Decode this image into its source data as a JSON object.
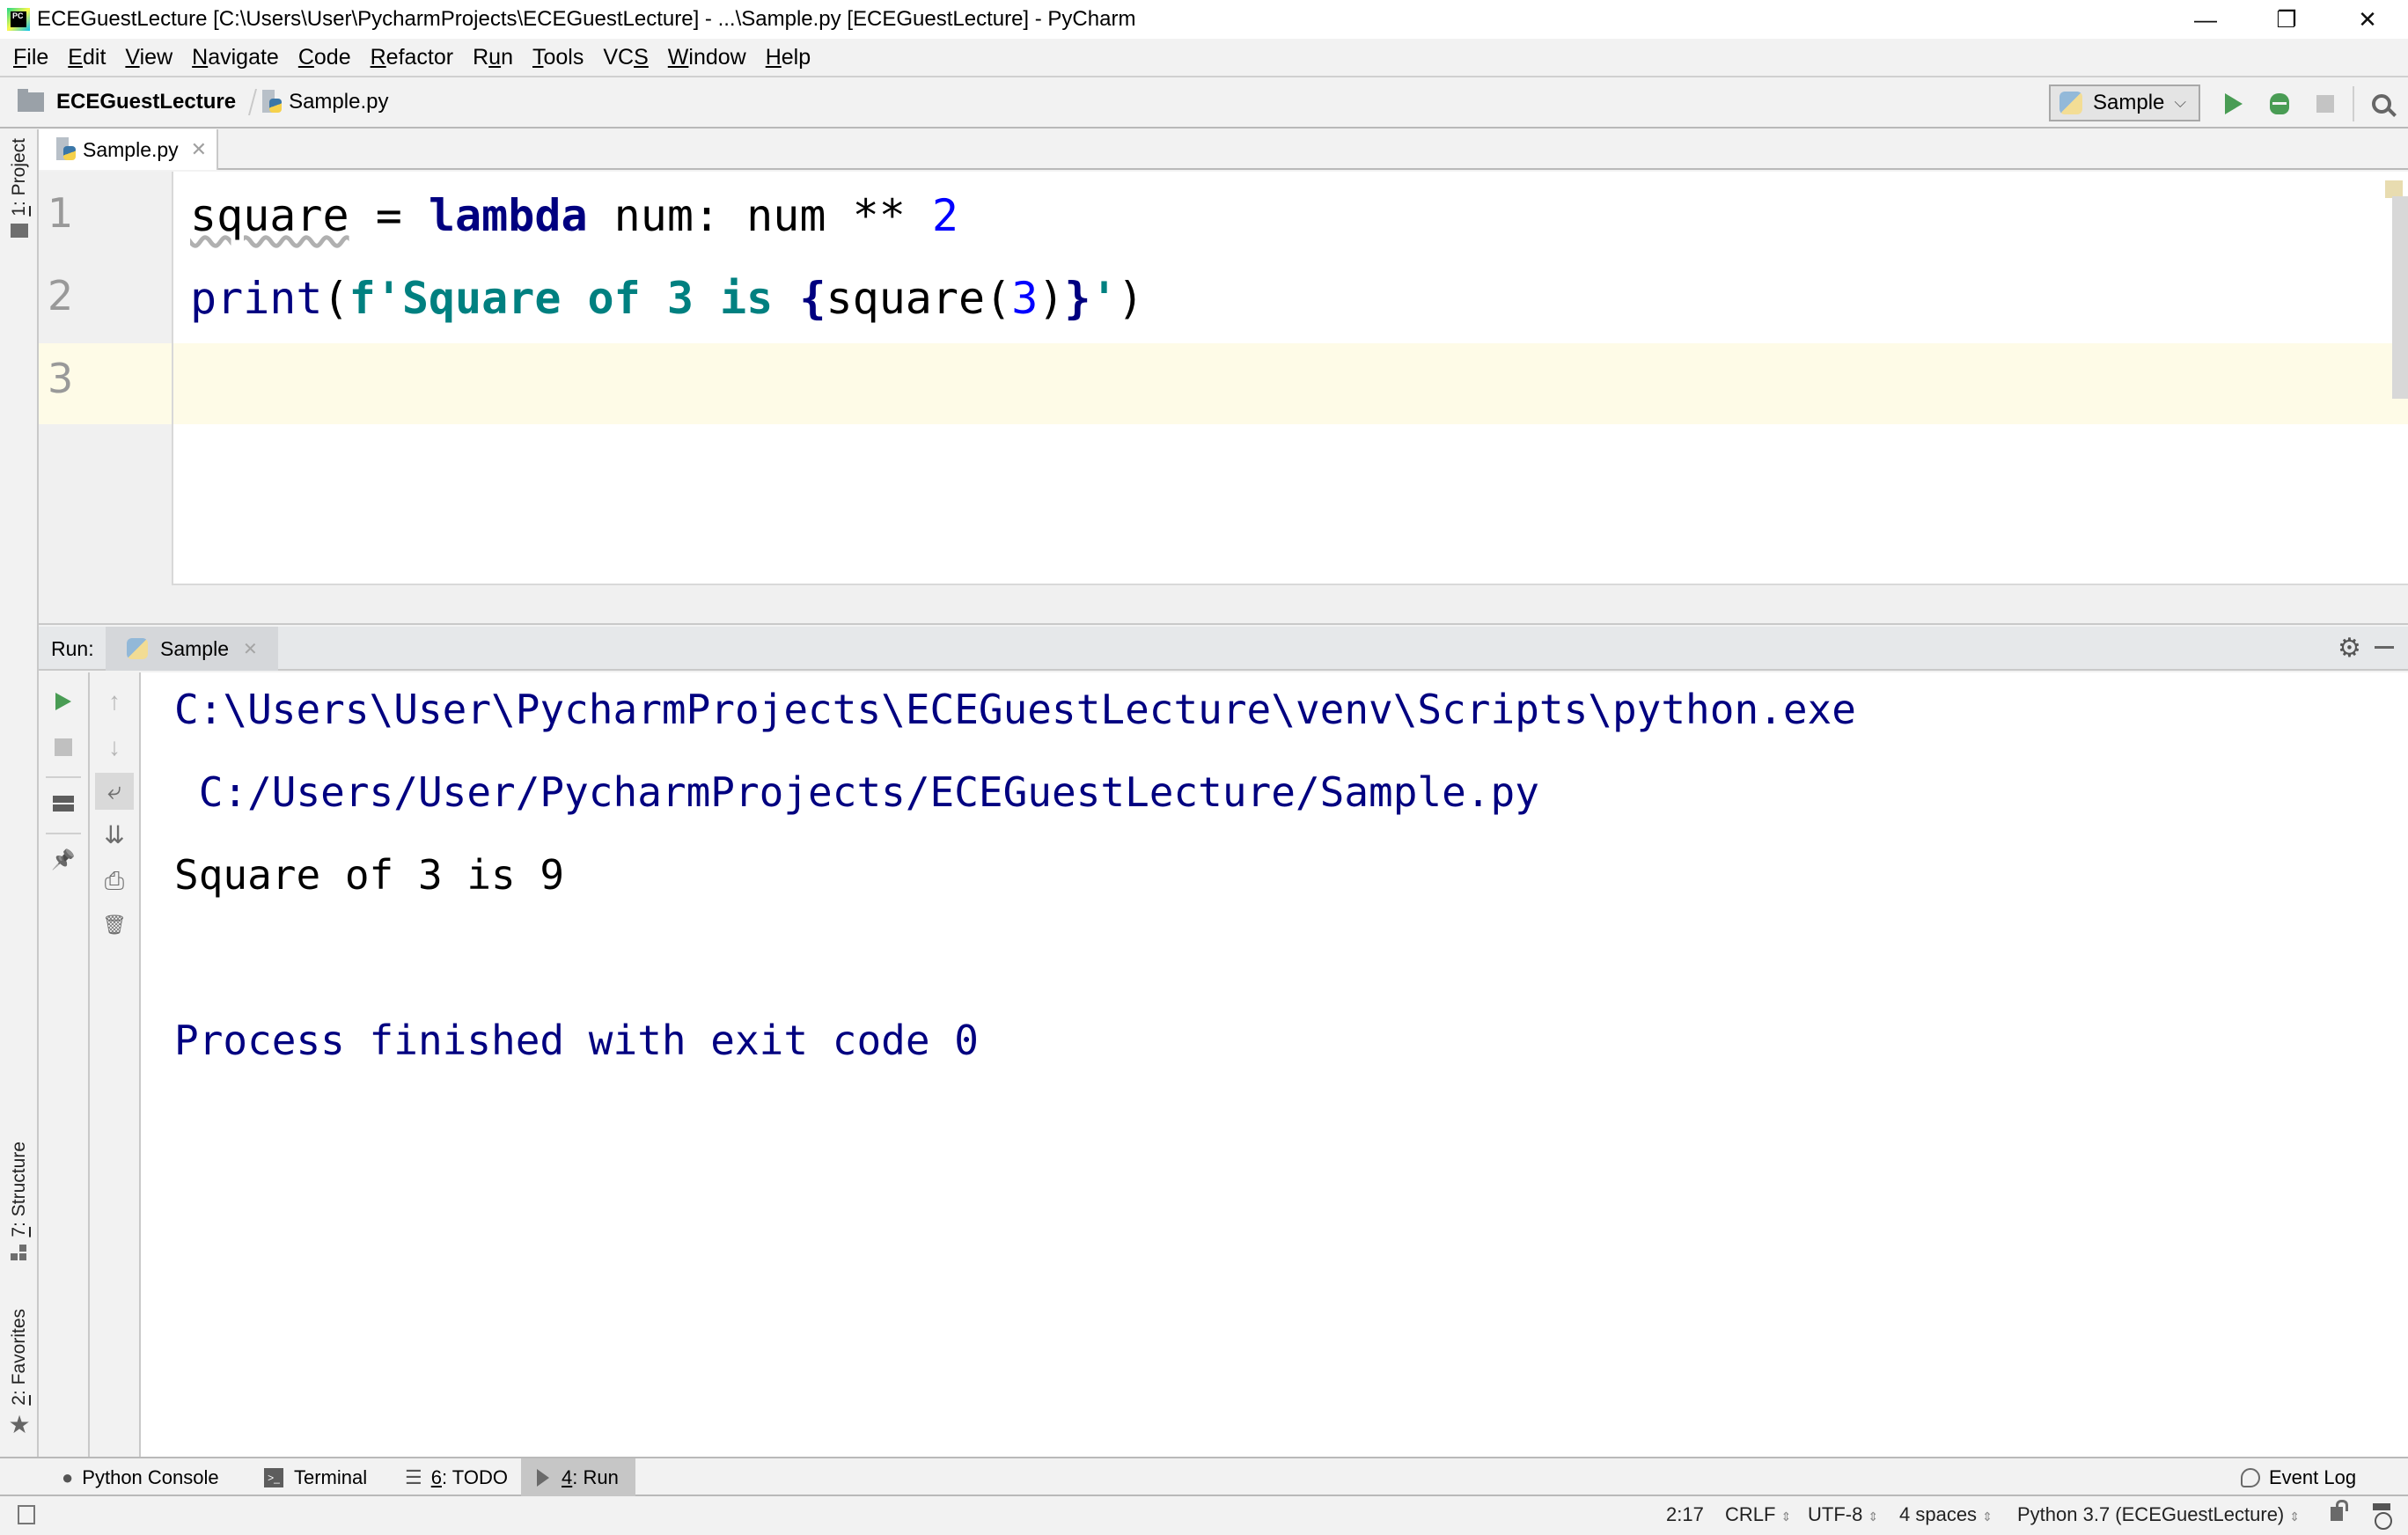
{
  "window": {
    "title": "ECEGuestLecture [C:\\Users\\User\\PycharmProjects\\ECEGuestLecture] - ...\\Sample.py [ECEGuestLecture] - PyCharm",
    "app_icon_text": "PC",
    "minimize": "—",
    "restore": "❐",
    "close": "✕"
  },
  "menu": [
    {
      "ul": "F",
      "rest": "ile"
    },
    {
      "ul": "E",
      "rest": "dit"
    },
    {
      "ul": "V",
      "rest": "iew"
    },
    {
      "ul": "N",
      "rest": "avigate"
    },
    {
      "ul": "C",
      "rest": "ode"
    },
    {
      "ul": "R",
      "rest": "efactor"
    },
    {
      "pre": "R",
      "ul": "u",
      "rest": "n"
    },
    {
      "ul": "T",
      "rest": "ools"
    },
    {
      "pre": "VC",
      "ul": "S",
      "rest": ""
    },
    {
      "ul": "W",
      "rest": "indow"
    },
    {
      "ul": "H",
      "rest": "elp"
    }
  ],
  "navbar": {
    "project": "ECEGuestLecture",
    "file": "Sample.py",
    "run_config": "Sample",
    "run_config_chevron": "⌵"
  },
  "sidebar_left": {
    "project": {
      "ul": "1",
      "rest": ": Project"
    },
    "structure": {
      "ul": "7",
      "rest": ": Structure"
    },
    "favorites": {
      "ul": "2",
      "rest": ": Favorites"
    },
    "star": "★"
  },
  "editor": {
    "tab": {
      "name": "Sample.py",
      "close": "✕"
    },
    "line_numbers": [
      "1",
      "2",
      "3"
    ],
    "lines": {
      "l1": {
        "var": "square",
        "eq": " = ",
        "kw": "lambda",
        "rest": " num: num ** ",
        "num": "2"
      },
      "l2": {
        "fn": "print",
        "open": "(",
        "fstr1": "f'Square of 3 is ",
        "brace_open": "{",
        "call": "square(",
        "arg": "3",
        "call_close": ")",
        "brace_close": "}",
        "fstr2": "'",
        "close": ")"
      },
      "l3": ""
    },
    "cursor": "2:17"
  },
  "run_panel": {
    "label": "Run:",
    "tab": {
      "name": "Sample",
      "close": "✕"
    },
    "gear": "⚙",
    "toolbar_left": [
      "rerun",
      "stop",
      "layout",
      "pin"
    ],
    "toolbar_right": {
      "up": "↑",
      "down": "↓",
      "wrap": "⤶",
      "scroll_end": "⇊",
      "print": "⎙",
      "trash": "🗑",
      "pin": "📌"
    },
    "console": {
      "line1": "C:\\Users\\User\\PycharmProjects\\ECEGuestLecture\\venv\\Scripts\\python.exe",
      "line2": " C:/Users/User/PycharmProjects/ECEGuestLecture/Sample.py",
      "line3": "Square of 3 is 9",
      "line4": "Process finished with exit code 0"
    }
  },
  "bottom_tabs": {
    "python_console": "Python Console",
    "terminal": "Terminal",
    "todo": {
      "ul": "6",
      "rest": ": TODO"
    },
    "run": {
      "ul": "4",
      "rest": ": Run"
    },
    "event_log": "Event Log"
  },
  "statusbar": {
    "position": "2:17",
    "line_sep": "CRLF",
    "encoding": "UTF-8",
    "indent": "4 spaces",
    "interpreter": "Python 3.7 (ECEGuestLecture)",
    "arrows": "⇕"
  },
  "colors": {
    "keyword": "#000080",
    "number": "#0000ff",
    "fstring": "#008080",
    "run_green": "#499c54",
    "current_line": "#fefbe7"
  }
}
